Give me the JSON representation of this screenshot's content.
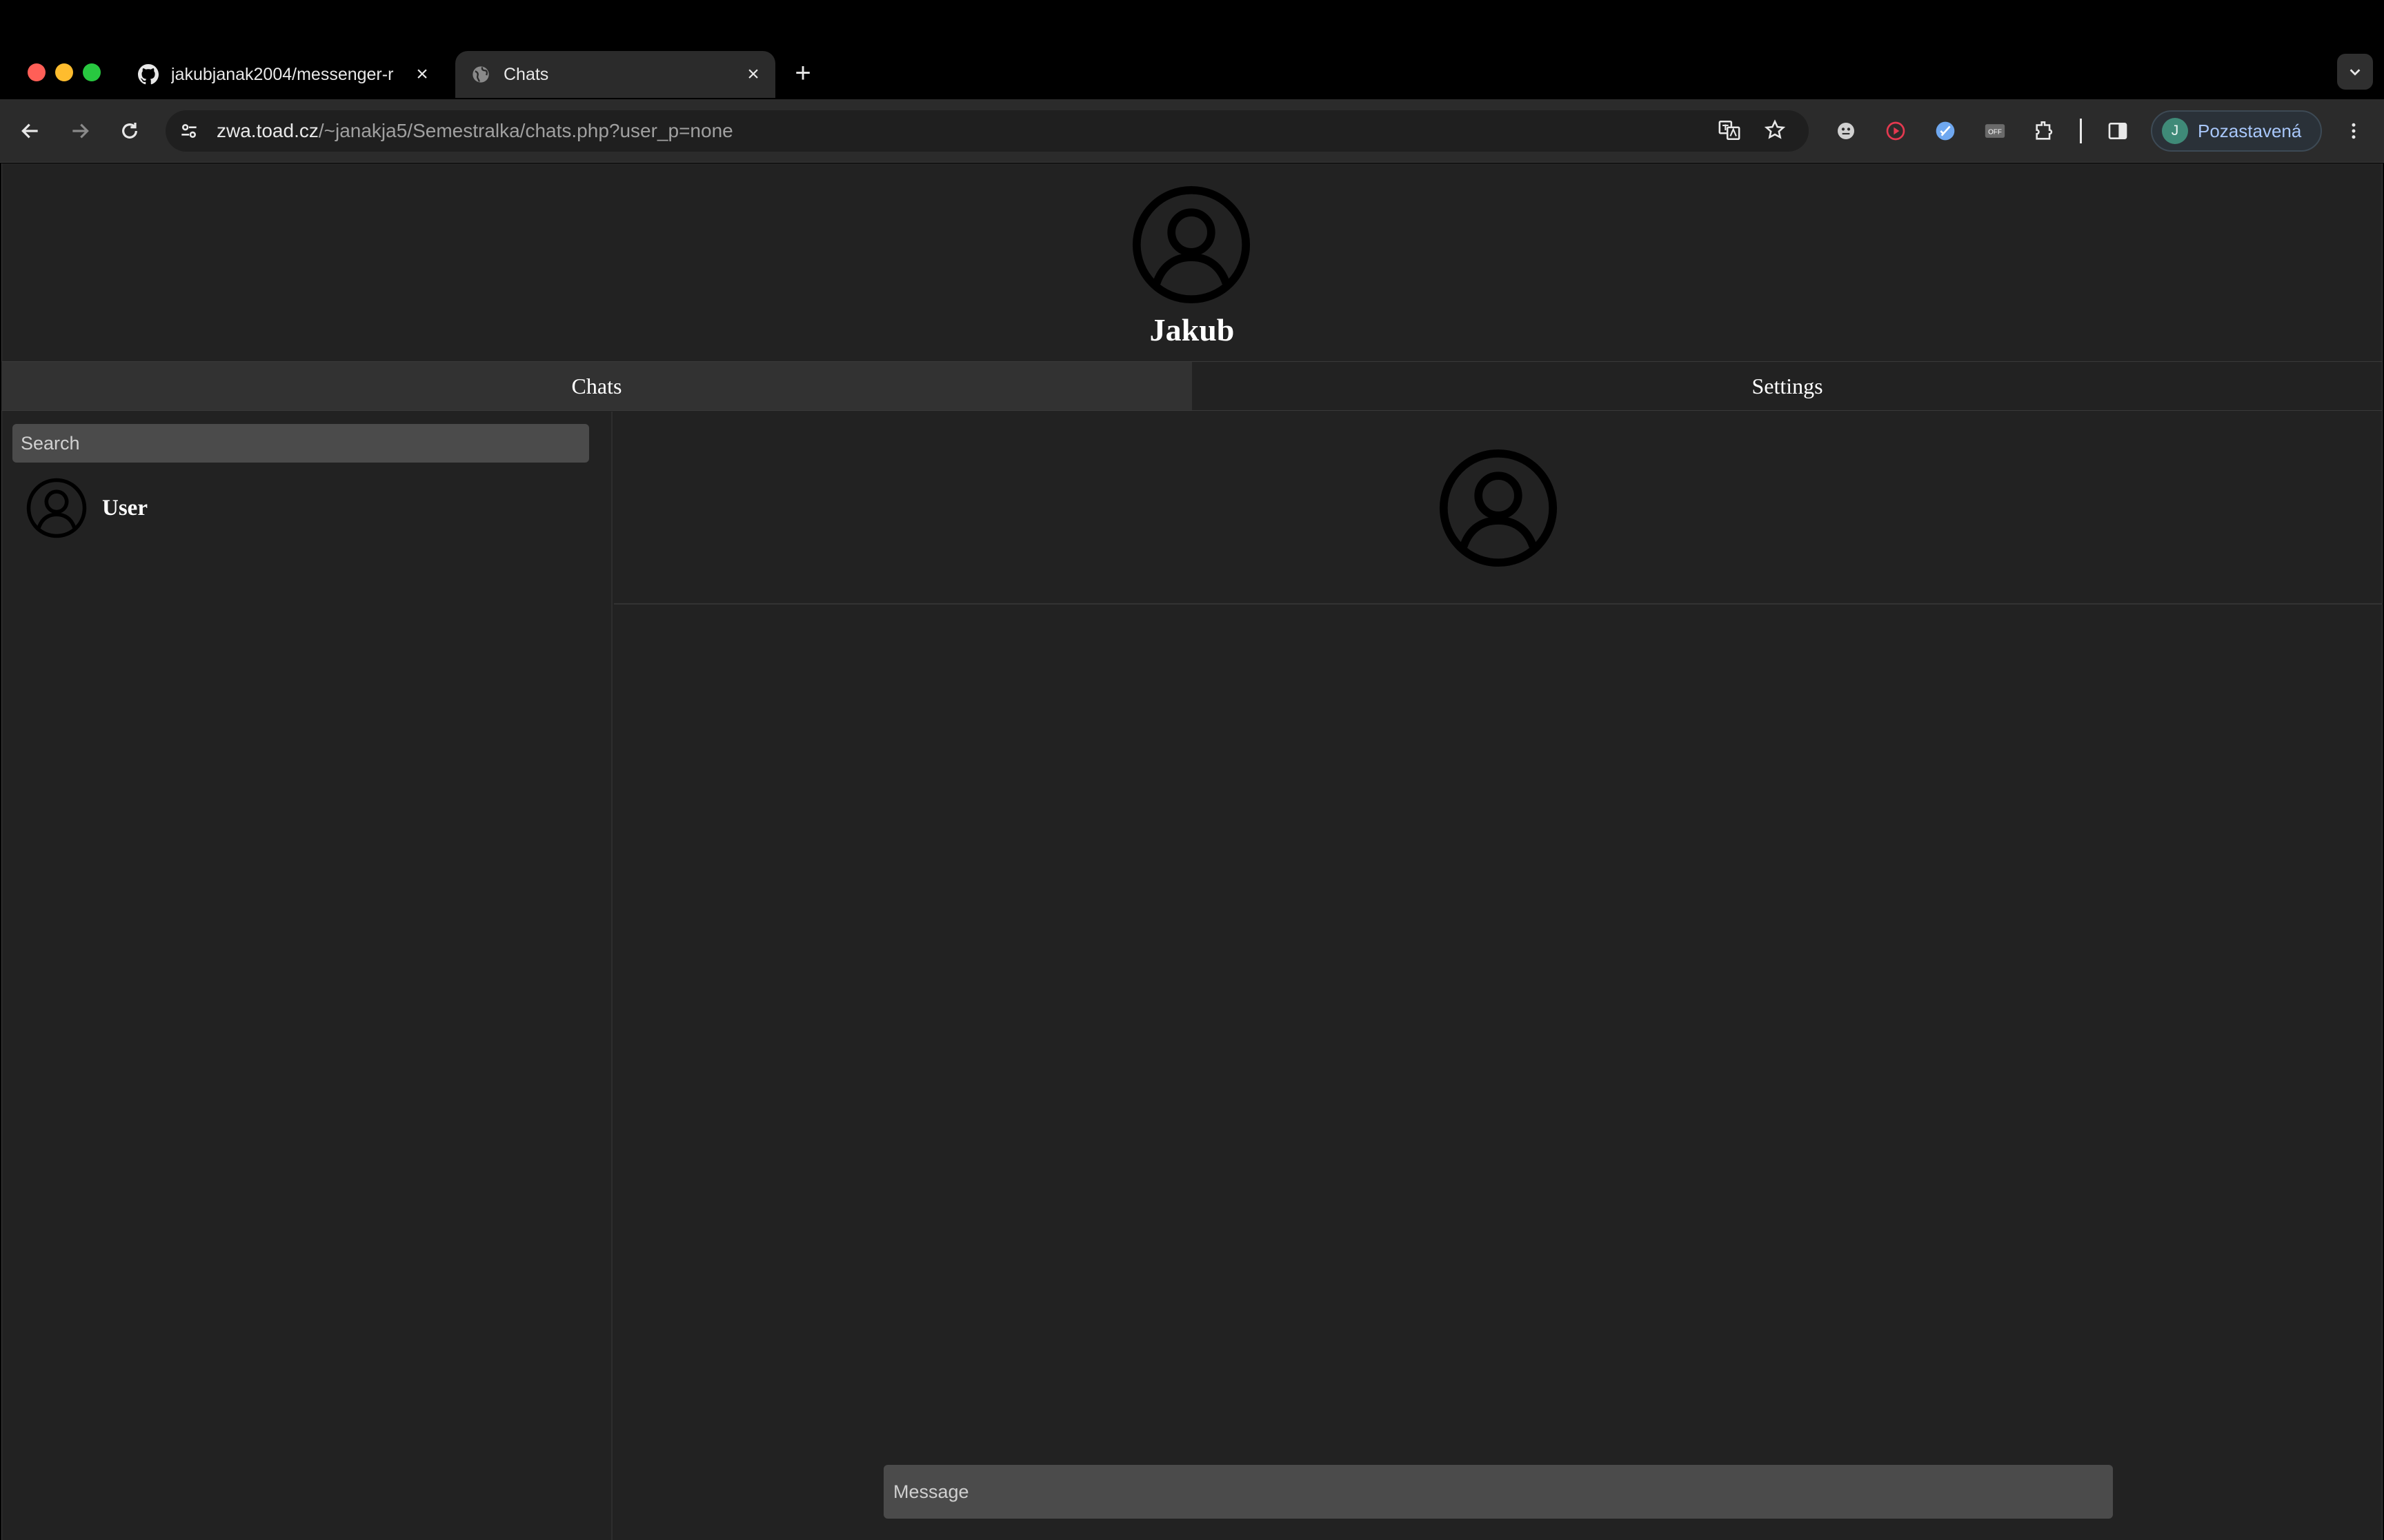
{
  "browser": {
    "tabs": [
      {
        "title": "jakubjanak2004/messenger-r",
        "favicon": "github-icon",
        "active": false
      },
      {
        "title": "Chats",
        "favicon": "globe-icon",
        "active": true
      }
    ],
    "url_host": "zwa.toad.cz",
    "url_path": "/~janakja5/Semestralka/chats.php?user_p=none",
    "profile": {
      "initial": "J",
      "label": "Pozastavená"
    },
    "colors": {
      "traffic_close": "#ff5f57",
      "traffic_min": "#febc2e",
      "traffic_max": "#28c840"
    }
  },
  "app": {
    "user_name": "Jakub",
    "tabs": [
      "Chats",
      "Settings"
    ],
    "search_placeholder": "Search",
    "contacts": [
      {
        "name": "User"
      }
    ],
    "message_placeholder": "Message"
  }
}
